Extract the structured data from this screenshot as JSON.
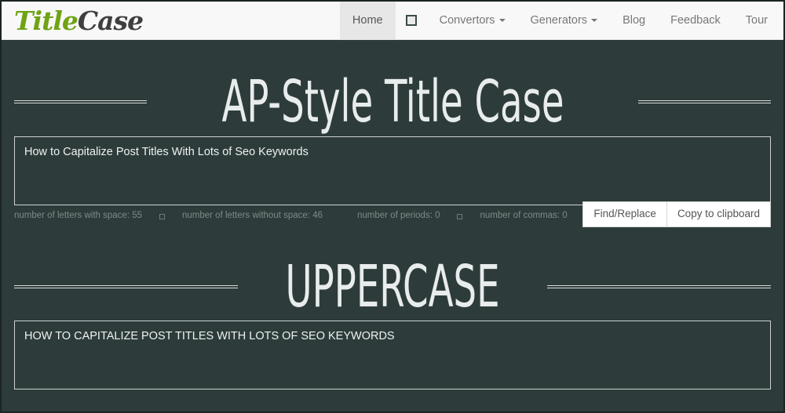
{
  "brand": {
    "part1": "Title",
    "part2": "Case",
    "color1": "#6fa314",
    "color2": "#3f3f3f"
  },
  "nav": {
    "items": [
      {
        "label": "Home",
        "active": true,
        "caret": false,
        "icon": null
      },
      {
        "label": "",
        "active": false,
        "caret": false,
        "icon": "box-icon"
      },
      {
        "label": "Convertors",
        "active": false,
        "caret": true,
        "icon": null
      },
      {
        "label": "Generators",
        "active": false,
        "caret": true,
        "icon": null
      },
      {
        "label": "Blog",
        "active": false,
        "caret": false,
        "icon": null
      },
      {
        "label": "Feedback",
        "active": false,
        "caret": false,
        "icon": null
      },
      {
        "label": "Tour",
        "active": false,
        "caret": false,
        "icon": null
      }
    ]
  },
  "sections": [
    {
      "heading": "AP-Style Title Case",
      "textarea_value": "How to Capitalize Post Titles With Lots of Seo Keywords"
    },
    {
      "heading": "UPPERCASE",
      "textarea_value": "HOW TO CAPITALIZE POST TITLES WITH LOTS OF SEO KEYWORDS"
    }
  ],
  "stats": {
    "letters_with_space": "number of letters with space: 55",
    "letters_without_space": "number of letters without space: 46",
    "periods": "number of periods: 0",
    "commas": "number of commas: 0"
  },
  "buttons": {
    "find_replace": "Find/Replace",
    "copy_clipboard": "Copy to clipboard"
  },
  "colors": {
    "page_background": "#2d3c3a",
    "navbar_background": "#f8f8f8",
    "active_tab_background": "#e7e7e7",
    "heading_text": "#e8ecec",
    "stats_text": "#7c8b87",
    "textarea_border": "#cdd2d1",
    "button_background": "#ffffff"
  }
}
